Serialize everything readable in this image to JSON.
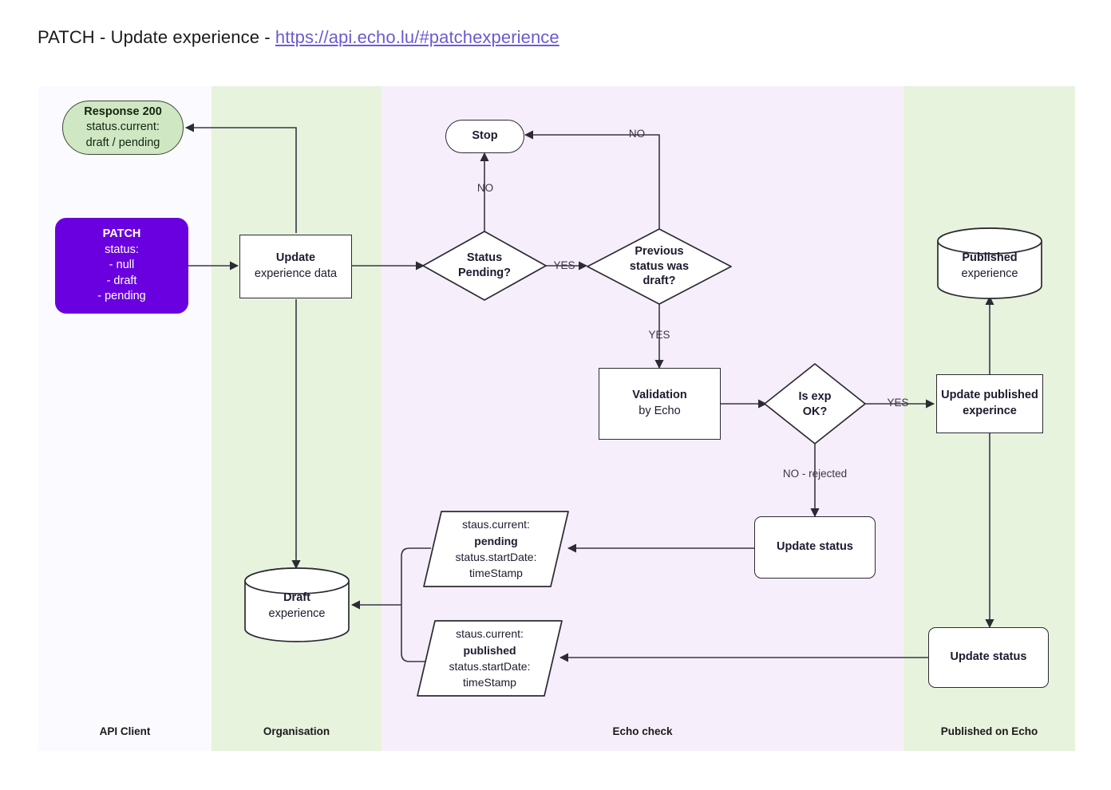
{
  "title": {
    "prefix": "PATCH - Update experience - ",
    "link": "https://api.echo.lu/#patchexperience"
  },
  "lanes": [
    {
      "id": "api-client",
      "label": "API Client",
      "color": "#fbfaff"
    },
    {
      "id": "organisation",
      "label": "Organisation",
      "color": "#e7f3dd"
    },
    {
      "id": "echo-check",
      "label": "Echo check",
      "color": "#f7eefb"
    },
    {
      "id": "published",
      "label": "Published on Echo",
      "color": "#e7f3dd"
    }
  ],
  "nodes": {
    "response": {
      "title": "Response 200",
      "line2": "status.current:",
      "line3": "draft / pending"
    },
    "patch": {
      "title": "PATCH",
      "line2": "status:",
      "line3": "- null",
      "line4": "- draft",
      "line5": "- pending"
    },
    "update_experience": {
      "title": "Update",
      "line2": "experience data"
    },
    "stop": {
      "title": "Stop"
    },
    "status_pending": {
      "line1": "Status",
      "line2": "Pending?"
    },
    "previous_draft": {
      "line1": "Previous",
      "line2": "status was",
      "line3": "draft?"
    },
    "validation": {
      "title": "Validation",
      "line2": "by Echo"
    },
    "is_exp_ok": {
      "line1": "Is exp",
      "line2": "OK?"
    },
    "update_published": {
      "line1": "Update published",
      "line2": "experince"
    },
    "published_db": {
      "title": "Published",
      "line2": "experience"
    },
    "draft_db": {
      "title": "Draft",
      "line2": "experience"
    },
    "update_status_mid": {
      "title": "Update status"
    },
    "update_status_bottom": {
      "title": "Update status"
    },
    "data_pending": {
      "line1": "staus.current:",
      "line2": "pending",
      "line3": "status.startDate:",
      "line4": "timeStamp"
    },
    "data_published": {
      "line1": "staus.current:",
      "line2": "published",
      "line3": "status.startDate:",
      "line4": "timeStamp"
    }
  },
  "edge_labels": {
    "no_status_pending": "NO",
    "yes_status_pending": "YES",
    "no_previous_draft": "NO",
    "yes_previous_draft": "YES",
    "yes_is_exp_ok": "YES",
    "no_is_exp_ok": "NO - rejected"
  },
  "colors": {
    "patch_fill": "#6a00e0",
    "response_fill": "#cfe8c3",
    "lane_green": "#e7f3dd",
    "lane_purple": "#f7eefb",
    "lane_white": "#fbfaff",
    "stroke": "#2b2b33",
    "link": "#6b5bd2"
  }
}
